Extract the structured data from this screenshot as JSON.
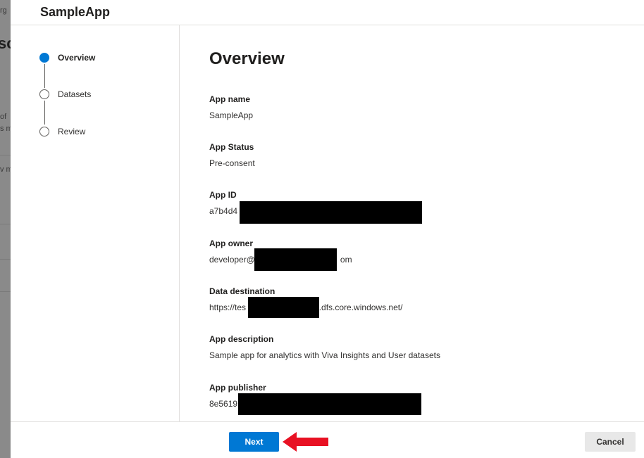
{
  "background_page": {
    "fragments": [
      "rg",
      "sc",
      "of",
      "s m",
      "v m"
    ]
  },
  "panel": {
    "title": "SampleApp"
  },
  "stepper": {
    "steps": [
      {
        "label": "Overview",
        "active": true
      },
      {
        "label": "Datasets",
        "active": false
      },
      {
        "label": "Review",
        "active": false
      }
    ]
  },
  "content": {
    "title": "Overview",
    "fields": [
      {
        "label": "App name",
        "value": "SampleApp"
      },
      {
        "label": "App Status",
        "value": "Pre-consent"
      },
      {
        "label": "App ID",
        "value_prefix": "a7b4d4"
      },
      {
        "label": "App owner",
        "value_prefix": "developer@",
        "value_suffix": "om"
      },
      {
        "label": "Data destination",
        "value_prefix": "https://tes",
        "value_suffix": "1.dfs.core.windows.net/"
      },
      {
        "label": "App description",
        "value": "Sample app for analytics with Viva Insights and User datasets"
      },
      {
        "label": "App publisher",
        "value_prefix": "8e5619"
      }
    ]
  },
  "footer": {
    "next_label": "Next",
    "cancel_label": "Cancel"
  },
  "colors": {
    "primary": "#0078d4",
    "annotation_arrow": "#e81123",
    "redaction": "#000000"
  }
}
